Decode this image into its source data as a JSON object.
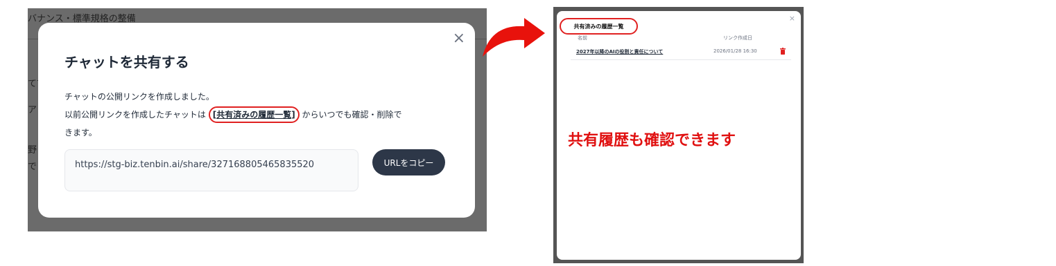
{
  "background_page": {
    "header_fragment": "バナンス・標準規格の整備",
    "side_fragments": [
      "て言",
      "ア",
      "野",
      "で"
    ]
  },
  "share_modal": {
    "title": "チャットを共有する",
    "close_symbol": "×",
    "body_line1": "チャットの公開リンクを作成しました。",
    "body_line2_prefix": "以前公開リンクを作成したチャットは ",
    "history_link_label": "共有済みの履歴一覧",
    "body_line2_suffix": " からいつでも確認・削除で",
    "body_line3": "きます。",
    "share_url": "https://stg-biz.tenbin.ai/share/327168805465835520",
    "copy_button_label": "URLをコピー"
  },
  "history_modal": {
    "title": "共有済みの履歴一覧",
    "close_symbol": "×",
    "columns": [
      "名前",
      "リンク作成日"
    ],
    "rows": [
      {
        "name": "2027年以降のAIの役割と責任について",
        "created": "2026/01/28 16:30",
        "action_icon": "trash-icon"
      }
    ]
  },
  "callout_text": "共有履歴も確認できます",
  "colors": {
    "accent_red": "#e02020",
    "button_dark": "#2d3748",
    "overlay_gray": "#6b6b6b"
  }
}
